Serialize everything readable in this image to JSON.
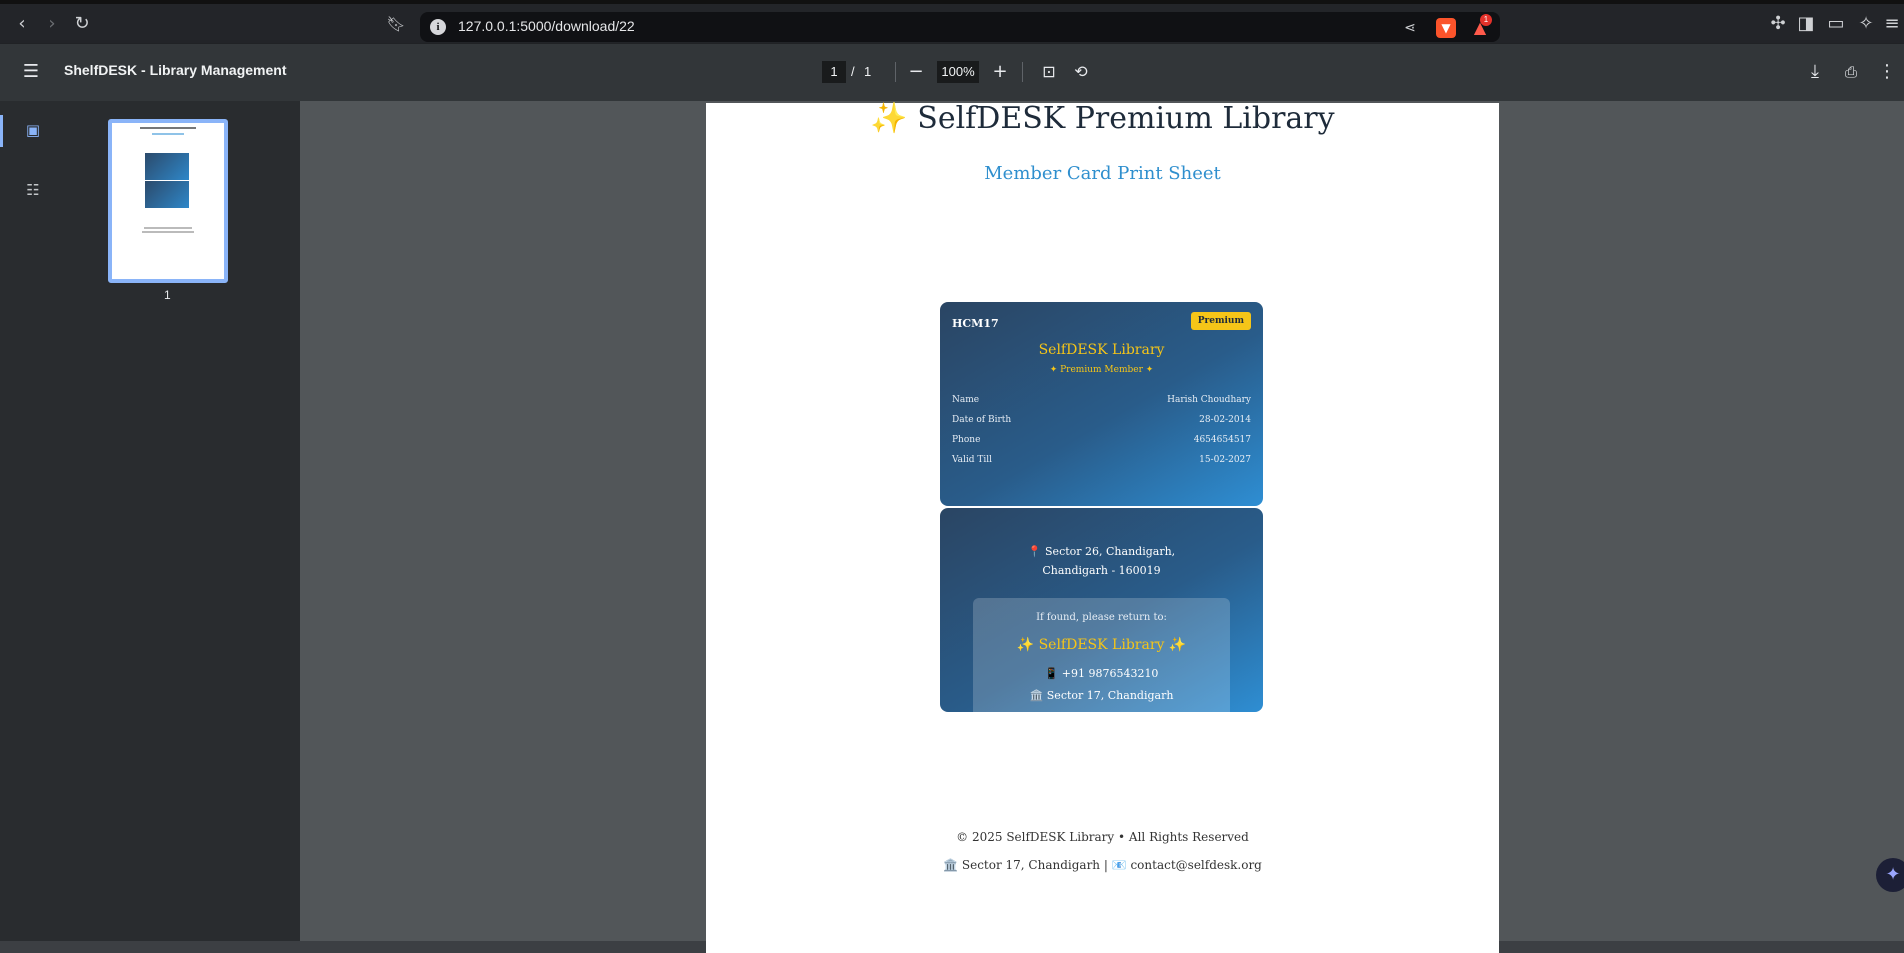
{
  "browser": {
    "url": "127.0.0.1:5000/download/22",
    "rewards_badge": "1"
  },
  "toolbar": {
    "title": "ShelfDESK - Library Management",
    "page_current": "1",
    "page_separator": "/",
    "page_total": "1",
    "zoom": "100%"
  },
  "sidebar": {
    "thumbnail_label": "1"
  },
  "document": {
    "title": "✨ SelfDESK Premium Library",
    "subtitle": "Member Card Print Sheet",
    "card_front": {
      "id": "HCM17",
      "badge": "Premium",
      "library": "SelfDESK Library",
      "member_type": "✦ Premium Member ✦",
      "fields": [
        {
          "label": "Name",
          "value": "Harish Choudhary"
        },
        {
          "label": "Date of Birth",
          "value": "28-02-2014"
        },
        {
          "label": "Phone",
          "value": "4654654517"
        },
        {
          "label": "Valid Till",
          "value": "15-02-2027"
        }
      ]
    },
    "card_back": {
      "address_line1": "📍 Sector 26, Chandigarh,",
      "address_line2": "Chandigarh - 160019",
      "return_label": "If found, please return to:",
      "return_library": "✨ SelfDESK Library ✨",
      "return_phone": "📱 +91 9876543210",
      "return_address": "🏛️ Sector 17, Chandigarh"
    },
    "footer": {
      "copyright": "© 2025 SelfDESK Library • All Rights Reserved",
      "contact": "🏛️ Sector 17, Chandigarh | 📧 contact@selfdesk.org"
    }
  }
}
